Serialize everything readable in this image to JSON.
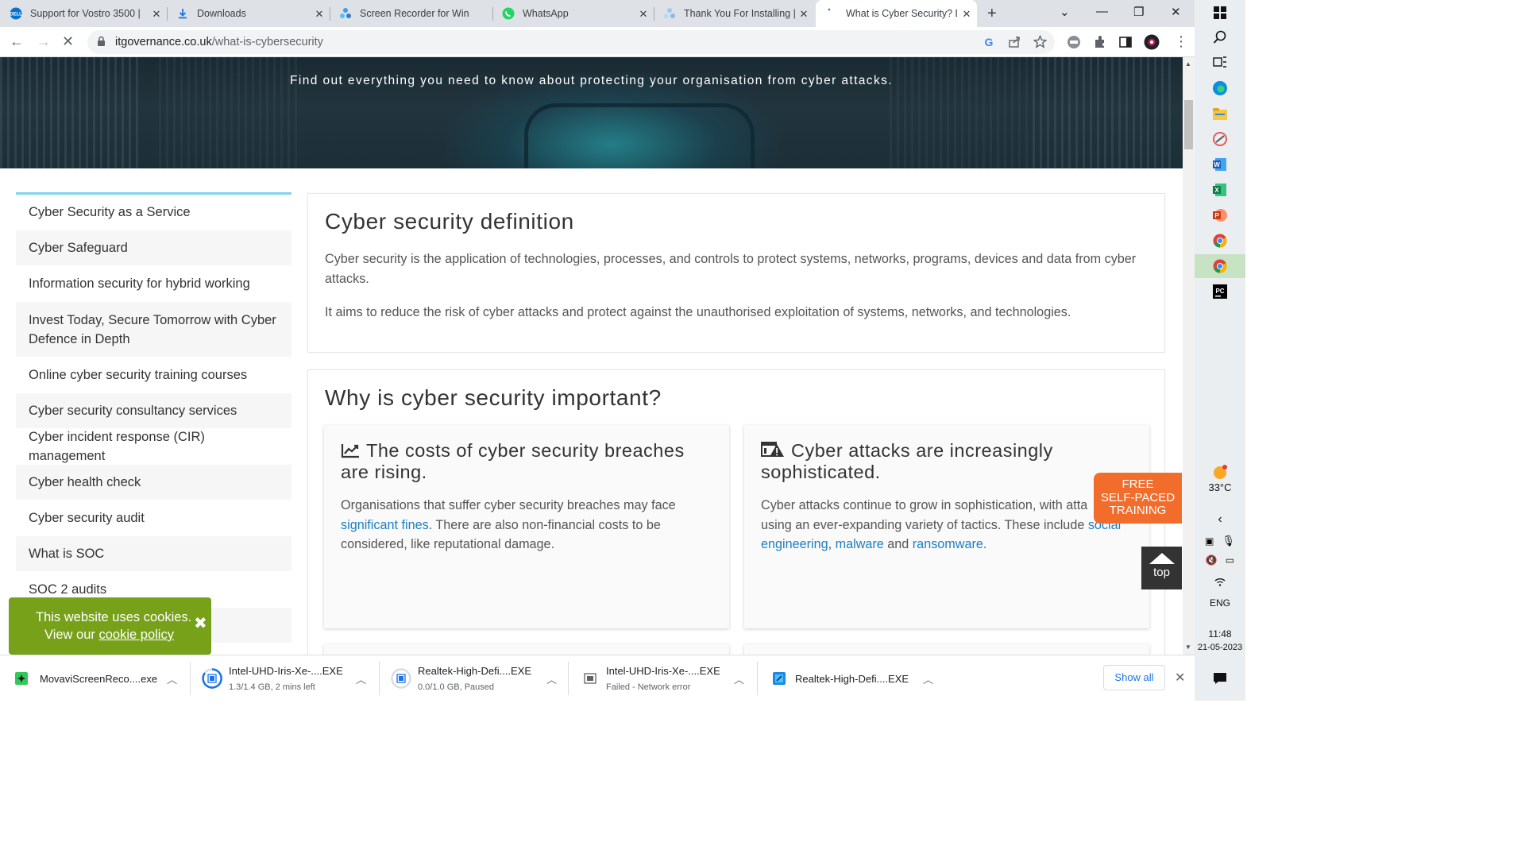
{
  "tabs": [
    {
      "title": "Support for Vostro 3500 |",
      "icon": "dell-icon"
    },
    {
      "title": "Downloads",
      "icon": "download-icon"
    },
    {
      "title": "Screen Recorder for Wind",
      "icon": "movavi-icon"
    },
    {
      "title": "WhatsApp",
      "icon": "whatsapp-icon"
    },
    {
      "title": "Thank You For Installing |",
      "icon": "movavi-icon"
    },
    {
      "title": "What is Cyber Security? D",
      "icon": "loading-icon",
      "active": true
    }
  ],
  "address": {
    "domain": "itgovernance.co.uk",
    "path": "/what-is-cybersecurity"
  },
  "hero": {
    "tagline": "Find out everything you need to know about protecting your organisation from cyber attacks."
  },
  "sidebar": {
    "items": [
      "Cyber Security as a Service",
      "Cyber Safeguard",
      "Information security for hybrid working",
      "Invest Today, Secure Tomorrow with Cyber Defence in Depth",
      "Online cyber security training courses",
      "Cyber security consultancy services",
      "Cyber incident response (CIR) management",
      "Cyber health check",
      "Cyber security audit",
      "What is SOC",
      "SOC 2 audits"
    ]
  },
  "definition": {
    "heading": "Cyber security definition",
    "p1": "Cyber security is the application of technologies, processes, and controls to protect systems, networks, programs, devices and data from cyber attacks.",
    "p2": "It aims to reduce the risk of cyber attacks and protect against the unauthorised exploitation of systems, networks, and technologies."
  },
  "why": {
    "heading": "Why is cyber security important?",
    "card1": {
      "title": "The costs of cyber security breaches are rising.",
      "text_a": "Organisations that suffer cyber security breaches may face ",
      "link_a": "significant fines",
      "text_b": ". There are also non-financial costs to be considered, like reputational damage."
    },
    "card2": {
      "title": "Cyber attacks are increasingly sophisticated.",
      "text_a": "Cyber attacks continue to grow in sophistication, with atta",
      "text_a2": "using an ever-expanding variety of tactics. These include ",
      "link_a": "social engineering",
      "sep1": ", ",
      "link_b": "malware",
      "sep2": " and ",
      "link_c": "ransomware",
      "end": "."
    }
  },
  "free_training": {
    "line1": "FREE",
    "line2": "SELF-PACED",
    "line3": "TRAINING"
  },
  "to_top": "top",
  "cookie": {
    "line1": "This website uses cookies.",
    "line2_pre": "View our ",
    "line2_link": "cookie policy"
  },
  "downloads": [
    {
      "name": "MovaviScreenReco....exe",
      "status": ""
    },
    {
      "name": "Intel-UHD-Iris-Xe-....EXE",
      "status": "1.3/1.4 GB, 2 mins left"
    },
    {
      "name": "Realtek-High-Defi....EXE",
      "status": "0.0/1.0 GB, Paused"
    },
    {
      "name": "Intel-UHD-Iris-Xe-....EXE",
      "status": "Failed - Network error"
    },
    {
      "name": "Realtek-High-Defi....EXE",
      "status": ""
    }
  ],
  "show_all": "Show all",
  "taskbar": {
    "weather_temp": "33°C",
    "language": "ENG",
    "time": "11:48",
    "date": "21-05-2023"
  }
}
